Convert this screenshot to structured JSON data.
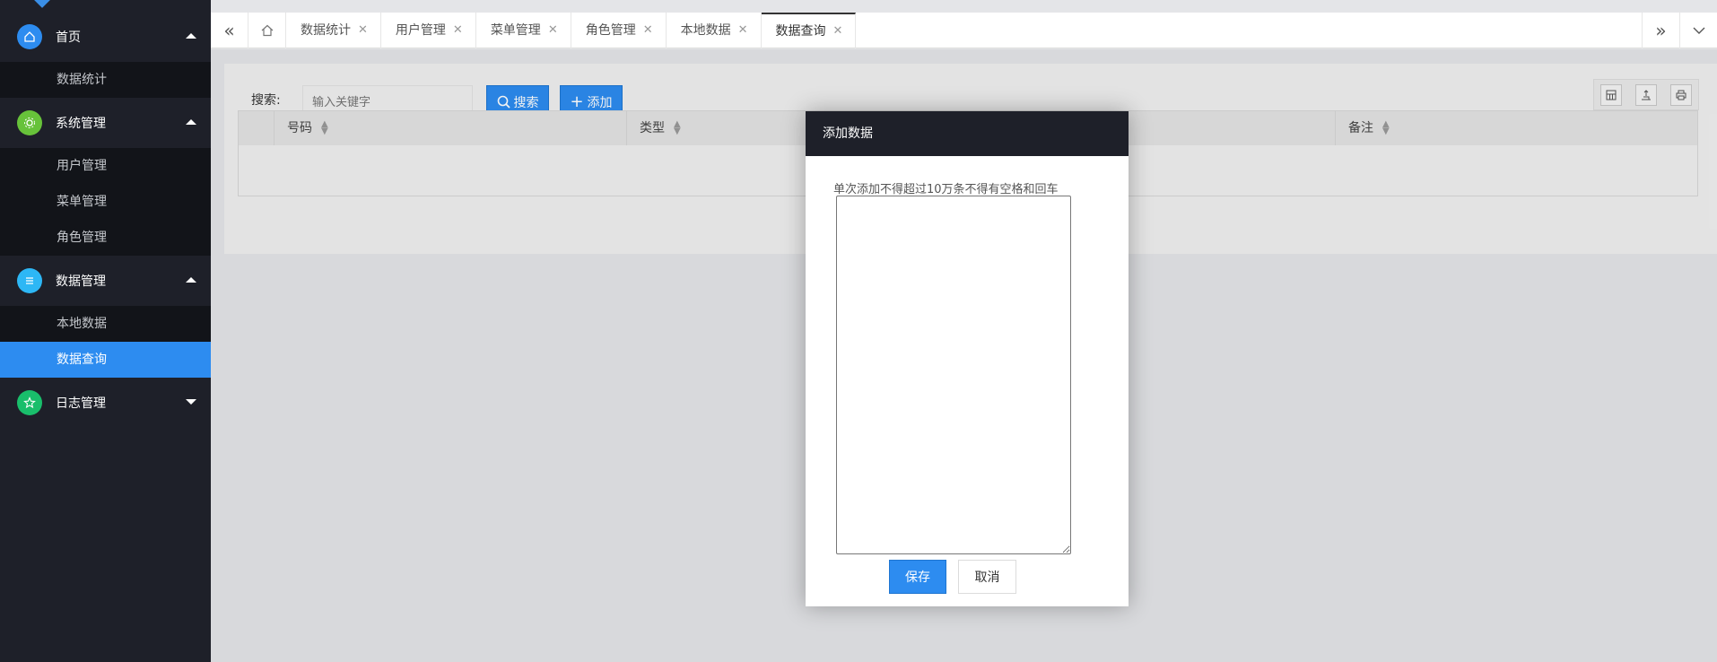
{
  "sidebar": {
    "groups": [
      {
        "label": "首页",
        "icon": "home-icon",
        "icon_color": "#2d8cf0",
        "expanded": true,
        "items": [
          {
            "label": "数据统计"
          }
        ]
      },
      {
        "label": "系统管理",
        "icon": "gear-icon",
        "icon_color": "#67c23a",
        "expanded": true,
        "items": [
          {
            "label": "用户管理"
          },
          {
            "label": "菜单管理"
          },
          {
            "label": "角色管理"
          }
        ]
      },
      {
        "label": "数据管理",
        "icon": "list-icon",
        "icon_color": "#2db7f5",
        "expanded": true,
        "items": [
          {
            "label": "本地数据"
          },
          {
            "label": "数据查询",
            "active": true
          }
        ]
      },
      {
        "label": "日志管理",
        "icon": "star-icon",
        "icon_color": "#19be6b",
        "expanded": false,
        "items": []
      }
    ]
  },
  "tabs": [
    {
      "label": "数据统计"
    },
    {
      "label": "用户管理"
    },
    {
      "label": "菜单管理"
    },
    {
      "label": "角色管理"
    },
    {
      "label": "本地数据"
    },
    {
      "label": "数据查询",
      "active": true
    }
  ],
  "toolbar": {
    "search_label": "搜索:",
    "search_placeholder": "输入关键字",
    "search_button": "搜索",
    "add_button": "添加"
  },
  "table": {
    "columns": [
      "号码",
      "类型",
      "备注"
    ]
  },
  "modal": {
    "title": "添加数据",
    "hint": "单次添加不得超过10万条不得有空格和回车",
    "save": "保存",
    "cancel": "取消"
  },
  "colors": {
    "sidebar_bg": "#1e2029",
    "accent": "#2d8cf0"
  }
}
